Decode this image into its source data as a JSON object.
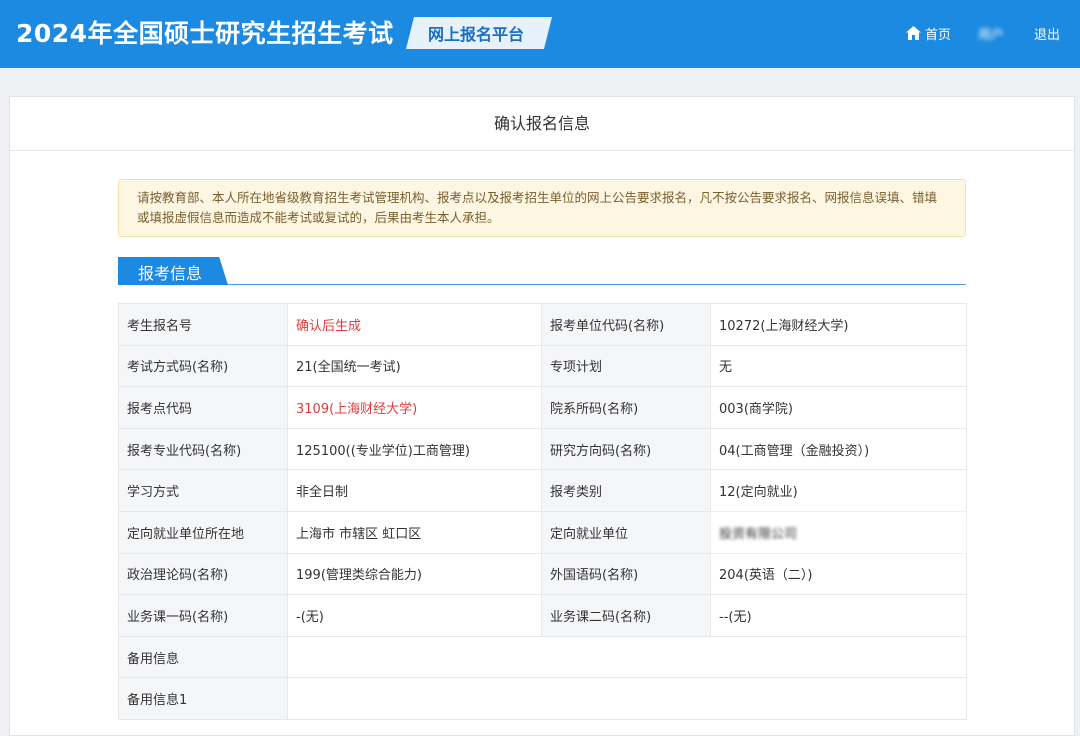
{
  "header": {
    "title": "2024年全国硕士研究生招生考试",
    "platform": "网上报名平台",
    "home_label": "首页",
    "user_label": "用户",
    "logout_label": "退出"
  },
  "page": {
    "title": "确认报名信息"
  },
  "notice": {
    "text": "请按教育部、本人所在地省级教育招生考试管理机构、报考点以及报考招生单位的网上公告要求报名，凡不按公告要求报名、网报信息误填、错填或填报虚假信息而造成不能考试或复试的，后果由考生本人承担。"
  },
  "section": {
    "title": "报考信息"
  },
  "rows": [
    {
      "l1": "考生报名号",
      "v1": "确认后生成",
      "l2": "报考单位代码(名称)",
      "v2": "10272(上海财经大学)"
    },
    {
      "l1": "考试方式码(名称)",
      "v1": "21(全国统一考试)",
      "l2": "专项计划",
      "v2": "无"
    },
    {
      "l1": "报考点代码",
      "v1": "3109(上海财经大学)",
      "l2": "院系所码(名称)",
      "v2": "003(商学院)"
    },
    {
      "l1": "报考专业代码(名称)",
      "v1": "125100((专业学位)工商管理)",
      "l2": "研究方向码(名称)",
      "v2": "04(工商管理（金融投资）)"
    },
    {
      "l1": "学习方式",
      "v1": "非全日制",
      "l2": "报考类别",
      "v2": "12(定向就业)"
    },
    {
      "l1": "定向就业单位所在地",
      "v1": "上海市 市辖区 虹口区",
      "l2": "定向就业单位",
      "v2": "投资有限公司"
    },
    {
      "l1": "政治理论码(名称)",
      "v1": "199(管理类综合能力)",
      "l2": "外国语码(名称)",
      "v2": "204(英语（二）)"
    },
    {
      "l1": "业务课一码(名称)",
      "v1": "-(无)",
      "l2": "业务课二码(名称)",
      "v2": "--(无)"
    },
    {
      "l1": "备用信息",
      "v1": ""
    },
    {
      "l1": "备用信息1",
      "v1": ""
    }
  ],
  "colors": {
    "topbar": "#1b8ae0",
    "accent_red": "#e03c3c",
    "notice_bg": "#fcf6e3"
  }
}
